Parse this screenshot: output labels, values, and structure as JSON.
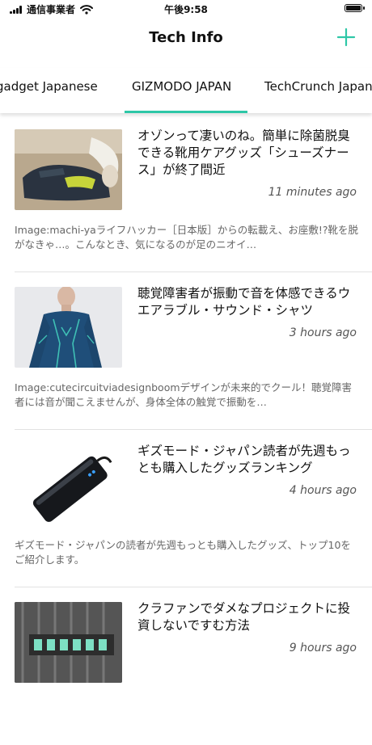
{
  "status_bar": {
    "carrier": "通信事業者",
    "time": "午後9:58"
  },
  "nav": {
    "title": "Tech Info"
  },
  "colors": {
    "accent": "#2ec7a7"
  },
  "tabs": [
    {
      "label": "Engadget Japanese"
    },
    {
      "label": "GIZMODO JAPAN",
      "selected": true
    },
    {
      "label": "TechCrunch Japan"
    }
  ],
  "articles": [
    {
      "headline": "オゾンって凄いのね。簡単に除菌脱臭できる靴用ケアグッズ「シューズナース」が終了間近",
      "time": "11 minutes ago",
      "summary": "Image:machi-yaライフハッカー［日本版］からの転載え、お座敷!?靴を脱がなきゃ…。こんなとき、気になるのが足のニオイ…"
    },
    {
      "headline": "聴覚障害者が振動で音を体感できるウエアラブル・サウンド・シャツ",
      "time": "3 hours ago",
      "summary": "Image:cutecircuitviadesignboomデザインが未来的でクール！聴覚障害者には音が聞こえませんが、身体全体の触覚で振動を…"
    },
    {
      "headline": "ギズモード・ジャパン読者が先週もっとも購入したグッズランキング",
      "time": "4 hours ago",
      "summary": "ギズモード・ジャパンの読者が先週もっとも購入したグッズ、トップ10をご紹介します。"
    },
    {
      "headline": "クラファンでダメなプロジェクトに投資しないですむ方法",
      "time": "9 hours ago",
      "summary": ""
    }
  ]
}
